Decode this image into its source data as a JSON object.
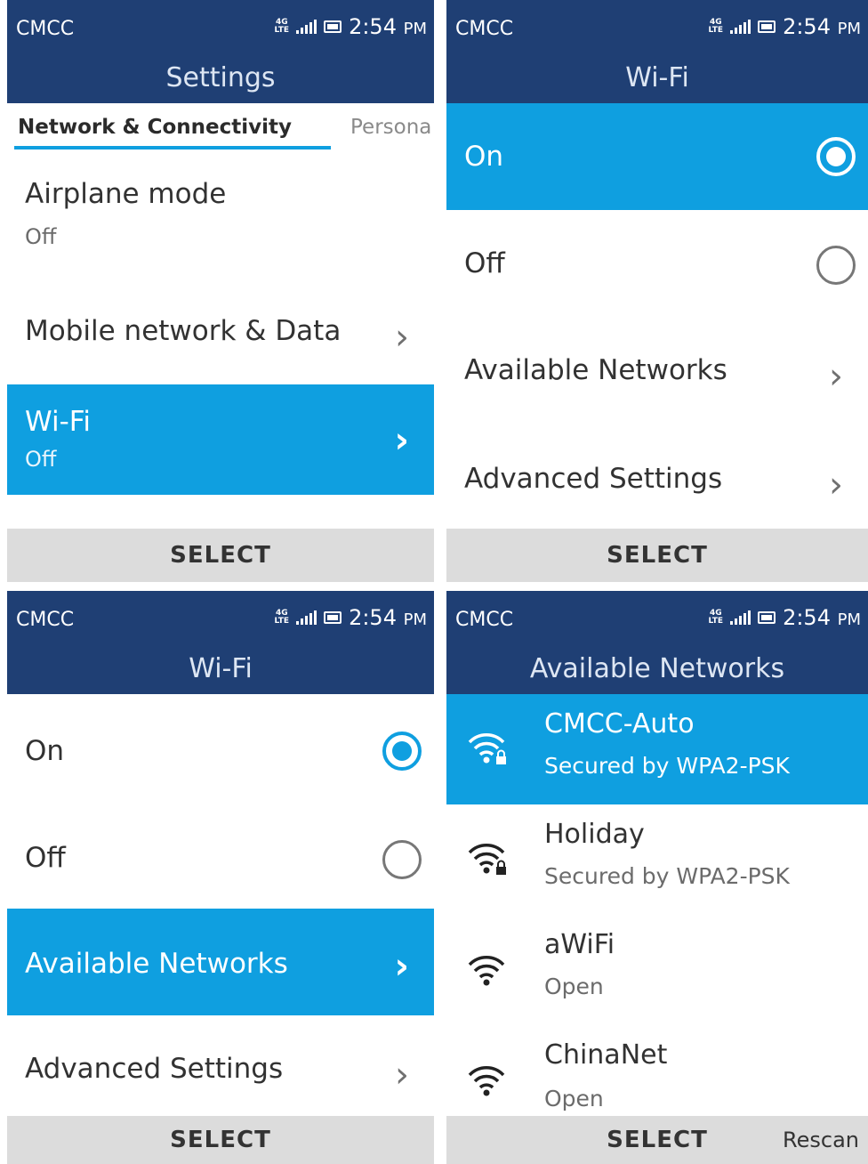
{
  "status": {
    "carrier": "CMCC",
    "network_type": "4G",
    "network_sub": "LTE",
    "time": "2:54",
    "ampm": "PM"
  },
  "screen1": {
    "title": "Settings",
    "tabs": [
      "Network & Connectivity",
      "Persona"
    ],
    "items": [
      {
        "label": "Airplane mode",
        "sub": "Off"
      },
      {
        "label": "Mobile network & Data"
      },
      {
        "label": "Wi-Fi",
        "sub": "Off",
        "selected": true
      }
    ],
    "softkey": "SELECT"
  },
  "screen2": {
    "title": "Wi-Fi",
    "items": [
      {
        "label": "On",
        "checked": true,
        "selected": true
      },
      {
        "label": "Off",
        "checked": false
      },
      {
        "label": "Available Networks"
      },
      {
        "label": "Advanced Settings"
      }
    ],
    "softkey": "SELECT"
  },
  "screen3": {
    "title": "Wi-Fi",
    "items": [
      {
        "label": "On",
        "checked": true
      },
      {
        "label": "Off",
        "checked": false
      },
      {
        "label": "Available Networks",
        "selected": true
      },
      {
        "label": "Advanced Settings"
      }
    ],
    "softkey": "SELECT"
  },
  "screen4": {
    "title": "Available Networks",
    "networks": [
      {
        "name": "CMCC-Auto",
        "security": "Secured by WPA2-PSK",
        "icon": "wifi-lock-icon",
        "selected": true
      },
      {
        "name": "Holiday",
        "security": "Secured by WPA2-PSK",
        "icon": "wifi-lock-icon"
      },
      {
        "name": "aWiFi",
        "security": "Open",
        "icon": "wifi-icon"
      },
      {
        "name": "ChinaNet",
        "security": "Open",
        "icon": "wifi-icon"
      }
    ],
    "softkey_center": "SELECT",
    "softkey_right": "Rescan"
  },
  "colors": {
    "header": "#1f3f74",
    "accent": "#0f9fe0",
    "softkey": "#dcdcdc"
  }
}
